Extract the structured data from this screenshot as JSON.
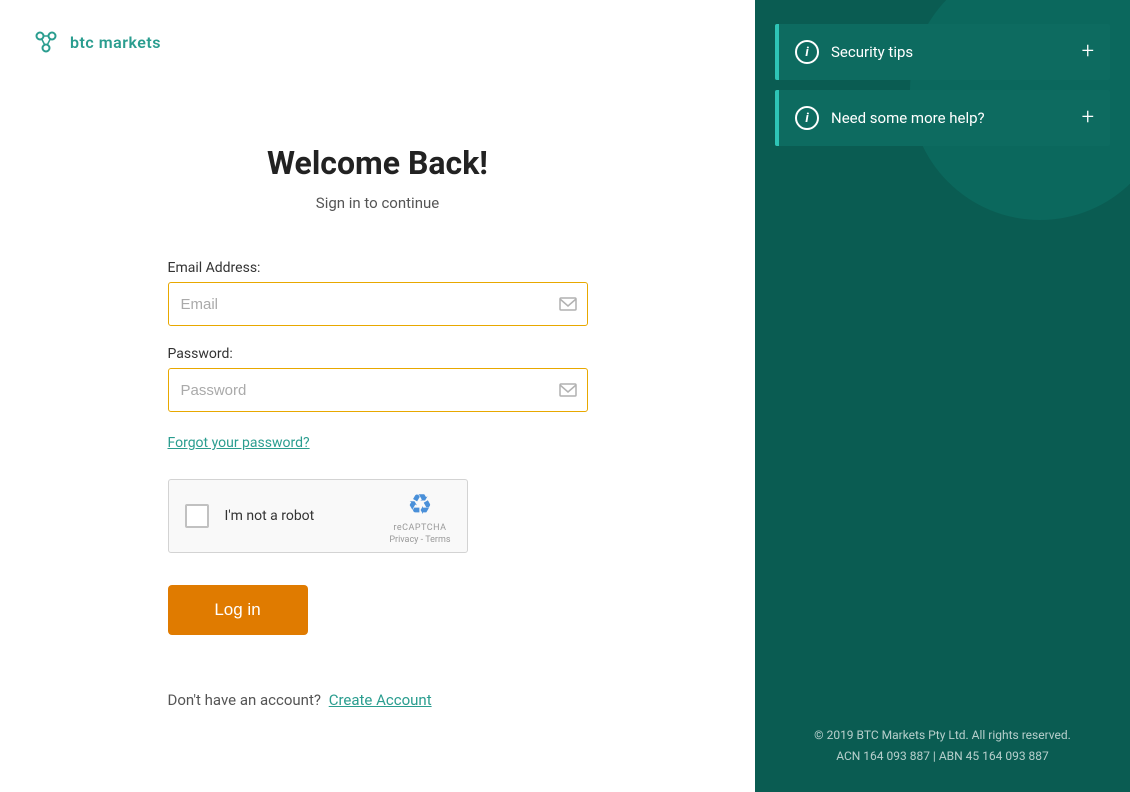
{
  "logo": {
    "text": "btc markets"
  },
  "form": {
    "title": "Welcome Back!",
    "subtitle": "Sign in to continue",
    "email_label": "Email Address:",
    "email_placeholder": "Email",
    "password_label": "Password:",
    "password_placeholder": "Password",
    "forgot_password_label": "Forgot your password?",
    "recaptcha_label": "I'm not a robot",
    "recaptcha_brand": "reCAPTCHA",
    "recaptcha_links": "Privacy - Terms",
    "login_button_label": "Log in",
    "no_account_text": "Don't have an account?",
    "create_account_label": "Create Account"
  },
  "sidebar": {
    "security_tips_label": "Security tips",
    "help_label": "Need some more help?"
  },
  "footer": {
    "line1": "© 2019 BTC Markets Pty Ltd. All rights reserved.",
    "line2": "ACN 164 093 887 | ABN 45 164 093 887"
  }
}
